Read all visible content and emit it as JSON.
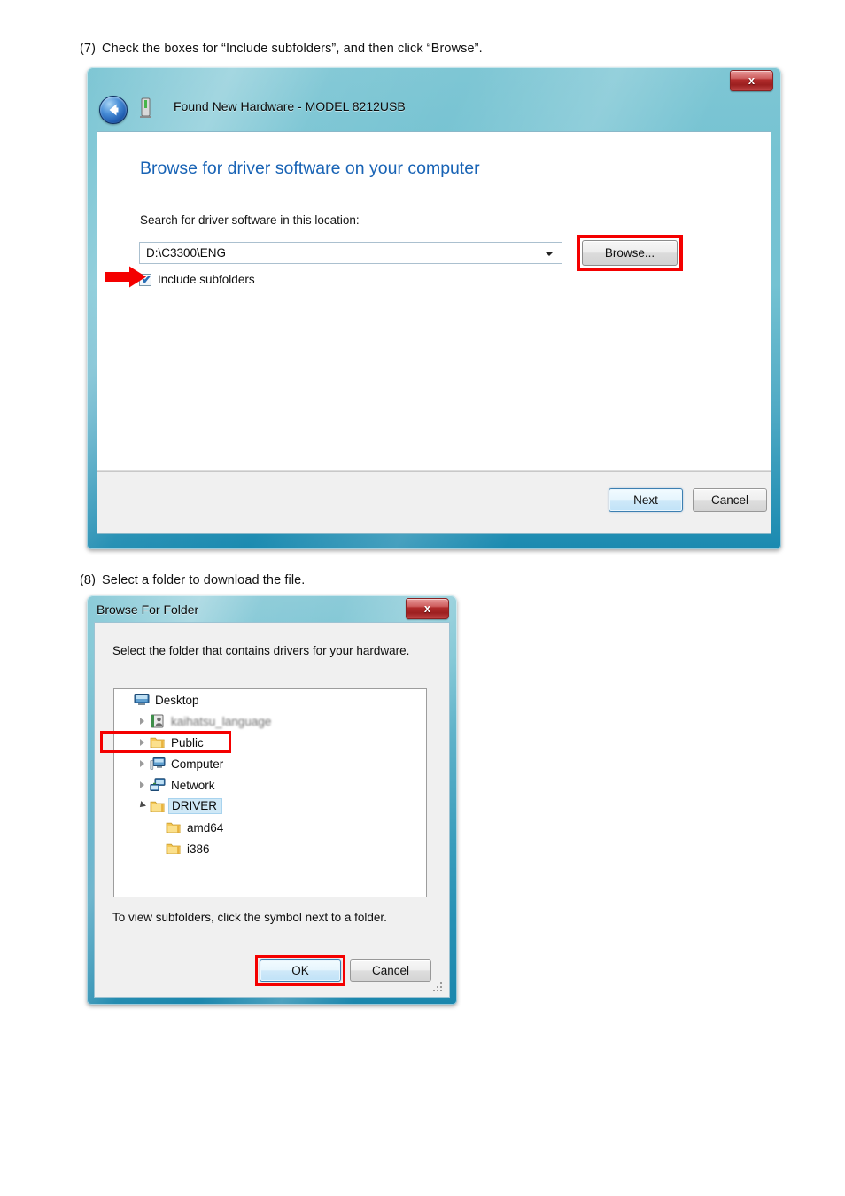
{
  "steps": [
    {
      "number": "(7)",
      "text": "Check the boxes for  “Include subfolders”, and then click “Browse”."
    },
    {
      "number": "(8)",
      "text": "Select a folder to download the file."
    }
  ],
  "wizard_dialog": {
    "title": "Found New Hardware - MODEL 8212USB",
    "close_label": "x",
    "heading": "Browse for driver software on your computer",
    "location_label": "Search for driver software in this location:",
    "location_value": "D:\\C3300\\ENG",
    "browse_label": "Browse...",
    "include_subfolders_label": "Include subfolders",
    "include_subfolders_checked": "✔",
    "next_label": "Next",
    "cancel_label": "Cancel",
    "highlight_color": "#f40000",
    "heading_color": "#1863b5",
    "frame_color": "#74c2d2"
  },
  "browse_dialog": {
    "title": "Browse For Folder",
    "close_label": "x",
    "prompt": "Select the folder that contains drivers for your hardware.",
    "hint": "To view subfolders, click the symbol next to a folder.",
    "ok_label": "OK",
    "cancel_label": "Cancel",
    "highlight_color": "#f40000",
    "tree": [
      {
        "label": "Desktop",
        "icon": "desktop-icon",
        "indent": 0,
        "expander": "none",
        "selected": false,
        "blurred": false
      },
      {
        "label": "kaihatsu_language",
        "icon": "contact-icon",
        "indent": 1,
        "expander": "collapsed",
        "selected": false,
        "blurred": true
      },
      {
        "label": "Public",
        "icon": "folder-icon",
        "indent": 1,
        "expander": "collapsed",
        "selected": false,
        "blurred": false
      },
      {
        "label": "Computer",
        "icon": "computer-icon",
        "indent": 1,
        "expander": "collapsed",
        "selected": false,
        "blurred": false
      },
      {
        "label": "Network",
        "icon": "network-icon",
        "indent": 1,
        "expander": "collapsed",
        "selected": false,
        "blurred": false
      },
      {
        "label": "DRIVER",
        "icon": "folder-icon",
        "indent": 1,
        "expander": "expanded",
        "selected": true,
        "blurred": false
      },
      {
        "label": "amd64",
        "icon": "folder-icon",
        "indent": 2,
        "expander": "none",
        "selected": false,
        "blurred": false
      },
      {
        "label": "i386",
        "icon": "folder-icon",
        "indent": 2,
        "expander": "none",
        "selected": false,
        "blurred": false
      }
    ]
  }
}
